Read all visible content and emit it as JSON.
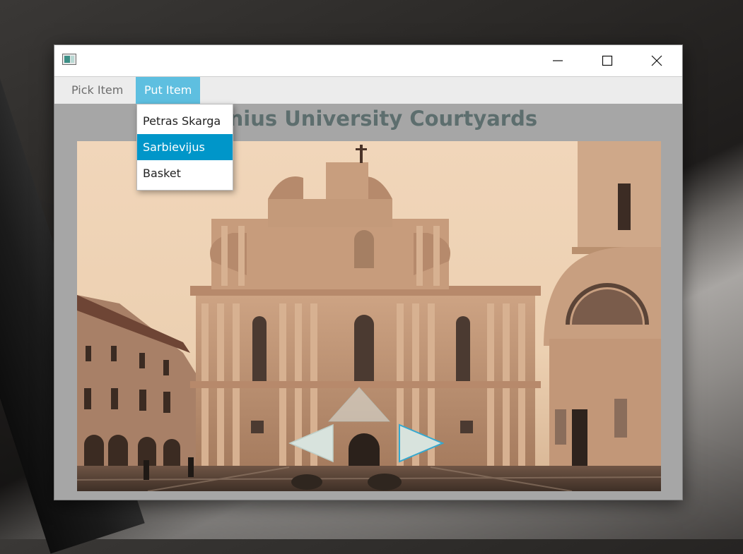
{
  "menubar": {
    "items": [
      {
        "label": "Pick Item"
      },
      {
        "label": "Put Item",
        "active": true
      }
    ]
  },
  "dropdown": {
    "items": [
      {
        "label": "Petras Skarga"
      },
      {
        "label": "Sarbievijus",
        "selected": true
      },
      {
        "label": "Basket"
      }
    ]
  },
  "main": {
    "title": "Vilnius University Courtyards"
  },
  "colors": {
    "accent": "#5ebfe0",
    "selection": "#0096c9",
    "title": "#5d6e6e",
    "background": "#a6a6a6"
  },
  "icons": [
    "app-icon",
    "minimize-icon",
    "maximize-icon",
    "close-icon",
    "arrow-left-icon",
    "arrow-right-icon",
    "arrow-up-icon"
  ]
}
